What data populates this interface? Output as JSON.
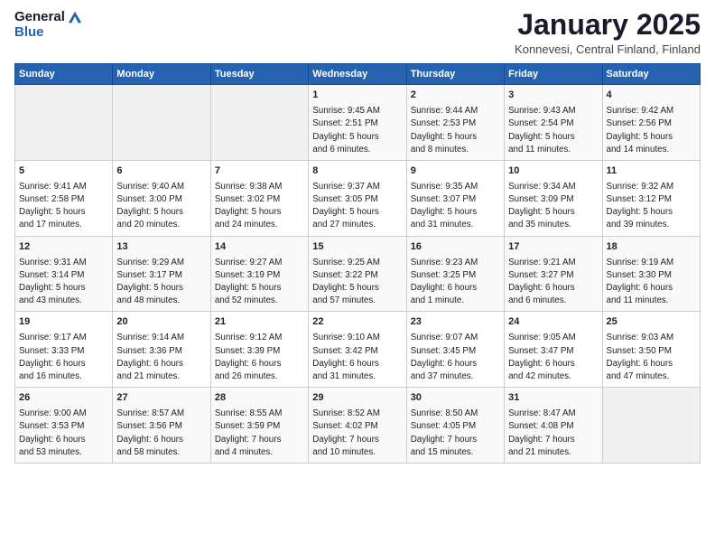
{
  "header": {
    "logo_general": "General",
    "logo_blue": "Blue",
    "title": "January 2025",
    "location": "Konnevesi, Central Finland, Finland"
  },
  "days_of_week": [
    "Sunday",
    "Monday",
    "Tuesday",
    "Wednesday",
    "Thursday",
    "Friday",
    "Saturday"
  ],
  "weeks": [
    [
      {
        "day": "",
        "detail": ""
      },
      {
        "day": "",
        "detail": ""
      },
      {
        "day": "",
        "detail": ""
      },
      {
        "day": "1",
        "detail": "Sunrise: 9:45 AM\nSunset: 2:51 PM\nDaylight: 5 hours\nand 6 minutes."
      },
      {
        "day": "2",
        "detail": "Sunrise: 9:44 AM\nSunset: 2:53 PM\nDaylight: 5 hours\nand 8 minutes."
      },
      {
        "day": "3",
        "detail": "Sunrise: 9:43 AM\nSunset: 2:54 PM\nDaylight: 5 hours\nand 11 minutes."
      },
      {
        "day": "4",
        "detail": "Sunrise: 9:42 AM\nSunset: 2:56 PM\nDaylight: 5 hours\nand 14 minutes."
      }
    ],
    [
      {
        "day": "5",
        "detail": "Sunrise: 9:41 AM\nSunset: 2:58 PM\nDaylight: 5 hours\nand 17 minutes."
      },
      {
        "day": "6",
        "detail": "Sunrise: 9:40 AM\nSunset: 3:00 PM\nDaylight: 5 hours\nand 20 minutes."
      },
      {
        "day": "7",
        "detail": "Sunrise: 9:38 AM\nSunset: 3:02 PM\nDaylight: 5 hours\nand 24 minutes."
      },
      {
        "day": "8",
        "detail": "Sunrise: 9:37 AM\nSunset: 3:05 PM\nDaylight: 5 hours\nand 27 minutes."
      },
      {
        "day": "9",
        "detail": "Sunrise: 9:35 AM\nSunset: 3:07 PM\nDaylight: 5 hours\nand 31 minutes."
      },
      {
        "day": "10",
        "detail": "Sunrise: 9:34 AM\nSunset: 3:09 PM\nDaylight: 5 hours\nand 35 minutes."
      },
      {
        "day": "11",
        "detail": "Sunrise: 9:32 AM\nSunset: 3:12 PM\nDaylight: 5 hours\nand 39 minutes."
      }
    ],
    [
      {
        "day": "12",
        "detail": "Sunrise: 9:31 AM\nSunset: 3:14 PM\nDaylight: 5 hours\nand 43 minutes."
      },
      {
        "day": "13",
        "detail": "Sunrise: 9:29 AM\nSunset: 3:17 PM\nDaylight: 5 hours\nand 48 minutes."
      },
      {
        "day": "14",
        "detail": "Sunrise: 9:27 AM\nSunset: 3:19 PM\nDaylight: 5 hours\nand 52 minutes."
      },
      {
        "day": "15",
        "detail": "Sunrise: 9:25 AM\nSunset: 3:22 PM\nDaylight: 5 hours\nand 57 minutes."
      },
      {
        "day": "16",
        "detail": "Sunrise: 9:23 AM\nSunset: 3:25 PM\nDaylight: 6 hours\nand 1 minute."
      },
      {
        "day": "17",
        "detail": "Sunrise: 9:21 AM\nSunset: 3:27 PM\nDaylight: 6 hours\nand 6 minutes."
      },
      {
        "day": "18",
        "detail": "Sunrise: 9:19 AM\nSunset: 3:30 PM\nDaylight: 6 hours\nand 11 minutes."
      }
    ],
    [
      {
        "day": "19",
        "detail": "Sunrise: 9:17 AM\nSunset: 3:33 PM\nDaylight: 6 hours\nand 16 minutes."
      },
      {
        "day": "20",
        "detail": "Sunrise: 9:14 AM\nSunset: 3:36 PM\nDaylight: 6 hours\nand 21 minutes."
      },
      {
        "day": "21",
        "detail": "Sunrise: 9:12 AM\nSunset: 3:39 PM\nDaylight: 6 hours\nand 26 minutes."
      },
      {
        "day": "22",
        "detail": "Sunrise: 9:10 AM\nSunset: 3:42 PM\nDaylight: 6 hours\nand 31 minutes."
      },
      {
        "day": "23",
        "detail": "Sunrise: 9:07 AM\nSunset: 3:45 PM\nDaylight: 6 hours\nand 37 minutes."
      },
      {
        "day": "24",
        "detail": "Sunrise: 9:05 AM\nSunset: 3:47 PM\nDaylight: 6 hours\nand 42 minutes."
      },
      {
        "day": "25",
        "detail": "Sunrise: 9:03 AM\nSunset: 3:50 PM\nDaylight: 6 hours\nand 47 minutes."
      }
    ],
    [
      {
        "day": "26",
        "detail": "Sunrise: 9:00 AM\nSunset: 3:53 PM\nDaylight: 6 hours\nand 53 minutes."
      },
      {
        "day": "27",
        "detail": "Sunrise: 8:57 AM\nSunset: 3:56 PM\nDaylight: 6 hours\nand 58 minutes."
      },
      {
        "day": "28",
        "detail": "Sunrise: 8:55 AM\nSunset: 3:59 PM\nDaylight: 7 hours\nand 4 minutes."
      },
      {
        "day": "29",
        "detail": "Sunrise: 8:52 AM\nSunset: 4:02 PM\nDaylight: 7 hours\nand 10 minutes."
      },
      {
        "day": "30",
        "detail": "Sunrise: 8:50 AM\nSunset: 4:05 PM\nDaylight: 7 hours\nand 15 minutes."
      },
      {
        "day": "31",
        "detail": "Sunrise: 8:47 AM\nSunset: 4:08 PM\nDaylight: 7 hours\nand 21 minutes."
      },
      {
        "day": "",
        "detail": ""
      }
    ]
  ]
}
